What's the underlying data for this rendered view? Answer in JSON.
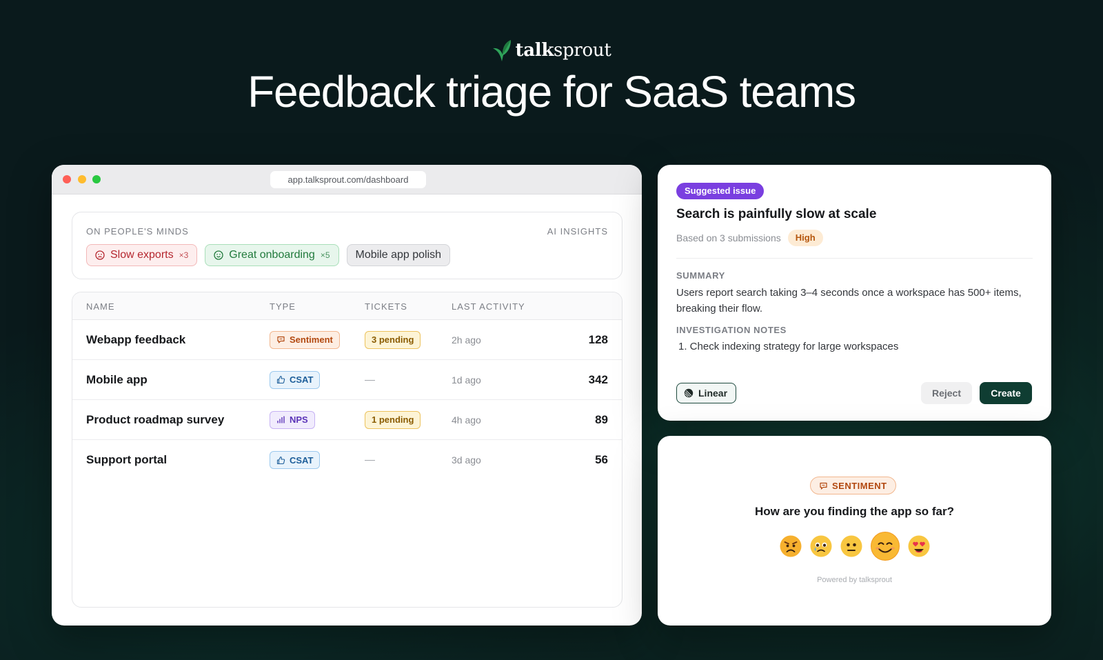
{
  "brand": {
    "name_bold": "talk",
    "name_rest": "sprout"
  },
  "headline": "Feedback triage for SaaS teams",
  "browser": {
    "url": "app.talksprout.com/dashboard",
    "insights": {
      "label": "ON PEOPLE'S MINDS",
      "ai_label": "AI INSIGHTS",
      "chips": [
        {
          "label": "Slow exports",
          "count": "×3",
          "tone": "negative"
        },
        {
          "label": "Great onboarding",
          "count": "×5",
          "tone": "positive"
        },
        {
          "label": "Mobile app polish",
          "tone": "neutral"
        }
      ]
    },
    "table": {
      "columns": [
        "NAME",
        "TYPE",
        "TICKETS",
        "LAST ACTIVITY"
      ],
      "rows": [
        {
          "name": "Webapp feedback",
          "type": "Sentiment",
          "tickets": "3 pending",
          "last_activity": "2h ago",
          "count": "128"
        },
        {
          "name": "Mobile app",
          "type": "CSAT",
          "tickets": "—",
          "last_activity": "1d ago",
          "count": "342"
        },
        {
          "name": "Product roadmap survey",
          "type": "NPS",
          "tickets": "1 pending",
          "last_activity": "4h ago",
          "count": "89"
        },
        {
          "name": "Support portal",
          "type": "CSAT",
          "tickets": "—",
          "last_activity": "3d ago",
          "count": "56"
        }
      ]
    }
  },
  "issue": {
    "badge": "Suggested issue",
    "title": "Search is painfully slow at scale",
    "based_on": "Based on 3 submissions",
    "priority": "High",
    "summary_label": "SUMMARY",
    "summary": "Users report search taking 3–4 seconds once a workspace has 500+ items, breaking their flow.",
    "notes_label": "INVESTIGATION NOTES",
    "notes": [
      "1. Check indexing strategy for large workspaces"
    ],
    "integration": "Linear",
    "reject": "Reject",
    "create": "Create"
  },
  "survey": {
    "badge": "SENTIMENT",
    "question": "How are you finding the app so far?",
    "options": [
      "angry",
      "sad",
      "neutral",
      "happy",
      "love"
    ],
    "selected": "happy",
    "powered_by": "Powered by talksprout"
  },
  "colors": {
    "background": "#0a1a1c",
    "accent_dark_green": "#0f3d32",
    "suggest_purple": "#7a3fe0"
  }
}
